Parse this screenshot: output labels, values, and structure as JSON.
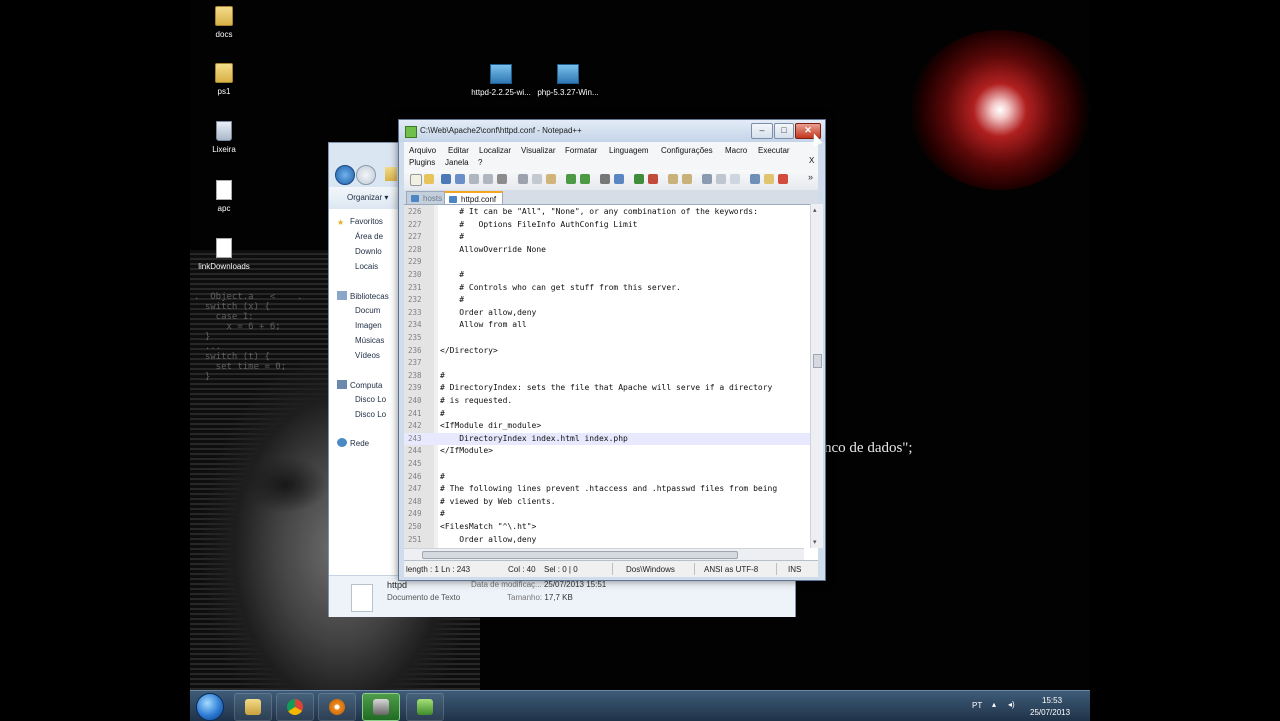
{
  "desktop": {
    "icons": [
      {
        "label": "docs",
        "icon": "folder-icon"
      },
      {
        "label": "ps1",
        "icon": "folder-icon"
      },
      {
        "label": "Lixeira",
        "icon": "recycle-bin-icon"
      },
      {
        "label": "apc",
        "icon": "document-icon"
      },
      {
        "label": "linkDownloads",
        "icon": "document-icon"
      },
      {
        "label": "httpd-2.2.25-wi...",
        "icon": "installer-icon"
      },
      {
        "label": "php-5.3.27-Win...",
        "icon": "installer-icon"
      }
    ],
    "wallpaper_text": "nco de dados\";",
    "glow_color": "#b12020"
  },
  "explorer": {
    "organize_label": "Organizar",
    "nav": [
      "Favoritos",
      "Área de",
      "Downlo",
      "Locais",
      "Bibliotecas",
      "Docum",
      "Imagen",
      "Músicas",
      "Vídeos",
      "Computa",
      "Disco Lo",
      "Disco Lo",
      "Rede"
    ],
    "details": {
      "name": "httpd",
      "type": "Documento de Texto",
      "modified_label": "Data de modificaç...",
      "modified_value": "25/07/2013 15:51",
      "size_label": "Tamanho:",
      "size_value": "17,7 KB"
    }
  },
  "notepad": {
    "title": "C:\\Web\\Apache2\\conf\\httpd.conf - Notepad++",
    "window_buttons": {
      "minimize": "–",
      "maximize": "□",
      "close": "✕"
    },
    "menu_row1": [
      "Arquivo",
      "Editar",
      "Localizar",
      "Visualizar",
      "Formatar",
      "Linguagem",
      "Configurações",
      "Macro",
      "Executar"
    ],
    "menu_row2": [
      "Plugins",
      "Janela",
      "?"
    ],
    "menu_close": "X",
    "toolbar_overflow": "»",
    "tabs": [
      {
        "label": "hosts",
        "active": false
      },
      {
        "label": "httpd.conf",
        "active": true
      }
    ],
    "lines": [
      {
        "n": "226",
        "text": "    # It can be \"All\", \"None\", or any combination of the keywords:"
      },
      {
        "n": "227",
        "text": "    #   Options FileInfo AuthConfig Limit"
      },
      {
        "n": "227",
        "text": "    #"
      },
      {
        "n": "228",
        "text": "    AllowOverride None"
      },
      {
        "n": "229",
        "text": ""
      },
      {
        "n": "230",
        "text": "    #"
      },
      {
        "n": "231",
        "text": "    # Controls who can get stuff from this server."
      },
      {
        "n": "232",
        "text": "    #"
      },
      {
        "n": "233",
        "text": "    Order allow,deny"
      },
      {
        "n": "234",
        "text": "    Allow from all"
      },
      {
        "n": "235",
        "text": ""
      },
      {
        "n": "236",
        "text": "</Directory>"
      },
      {
        "n": "237",
        "text": ""
      },
      {
        "n": "238",
        "text": "#"
      },
      {
        "n": "239",
        "text": "# DirectoryIndex: sets the file that Apache will serve if a directory"
      },
      {
        "n": "240",
        "text": "# is requested."
      },
      {
        "n": "241",
        "text": "#"
      },
      {
        "n": "242",
        "text": "<IfModule dir_module>"
      },
      {
        "n": "243",
        "text": "    DirectoryIndex index.html index.php"
      },
      {
        "n": "244",
        "text": "</IfModule>"
      },
      {
        "n": "245",
        "text": ""
      },
      {
        "n": "246",
        "text": "#"
      },
      {
        "n": "247",
        "text": "# The following lines prevent .htaccess and .htpasswd files from being"
      },
      {
        "n": "248",
        "text": "# viewed by Web clients."
      },
      {
        "n": "249",
        "text": "#"
      },
      {
        "n": "250",
        "text": "<FilesMatch \"^\\.ht\">"
      },
      {
        "n": "251",
        "text": "    Order allow,deny"
      }
    ],
    "current_line": 243,
    "status": {
      "length": "length : 1 Ln : 243",
      "col": "Col : 40",
      "sel": "Sel : 0 | 0",
      "eol": "Dos\\Windows",
      "encoding": "ANSI as UTF-8",
      "mode": "INS"
    }
  },
  "taskbar": {
    "buttons": [
      "start-button",
      "explorer",
      "chrome",
      "media-player",
      "putty",
      "notepad-plus-plus"
    ],
    "language": "PT",
    "time": "15:53",
    "date": "25/07/2013"
  }
}
